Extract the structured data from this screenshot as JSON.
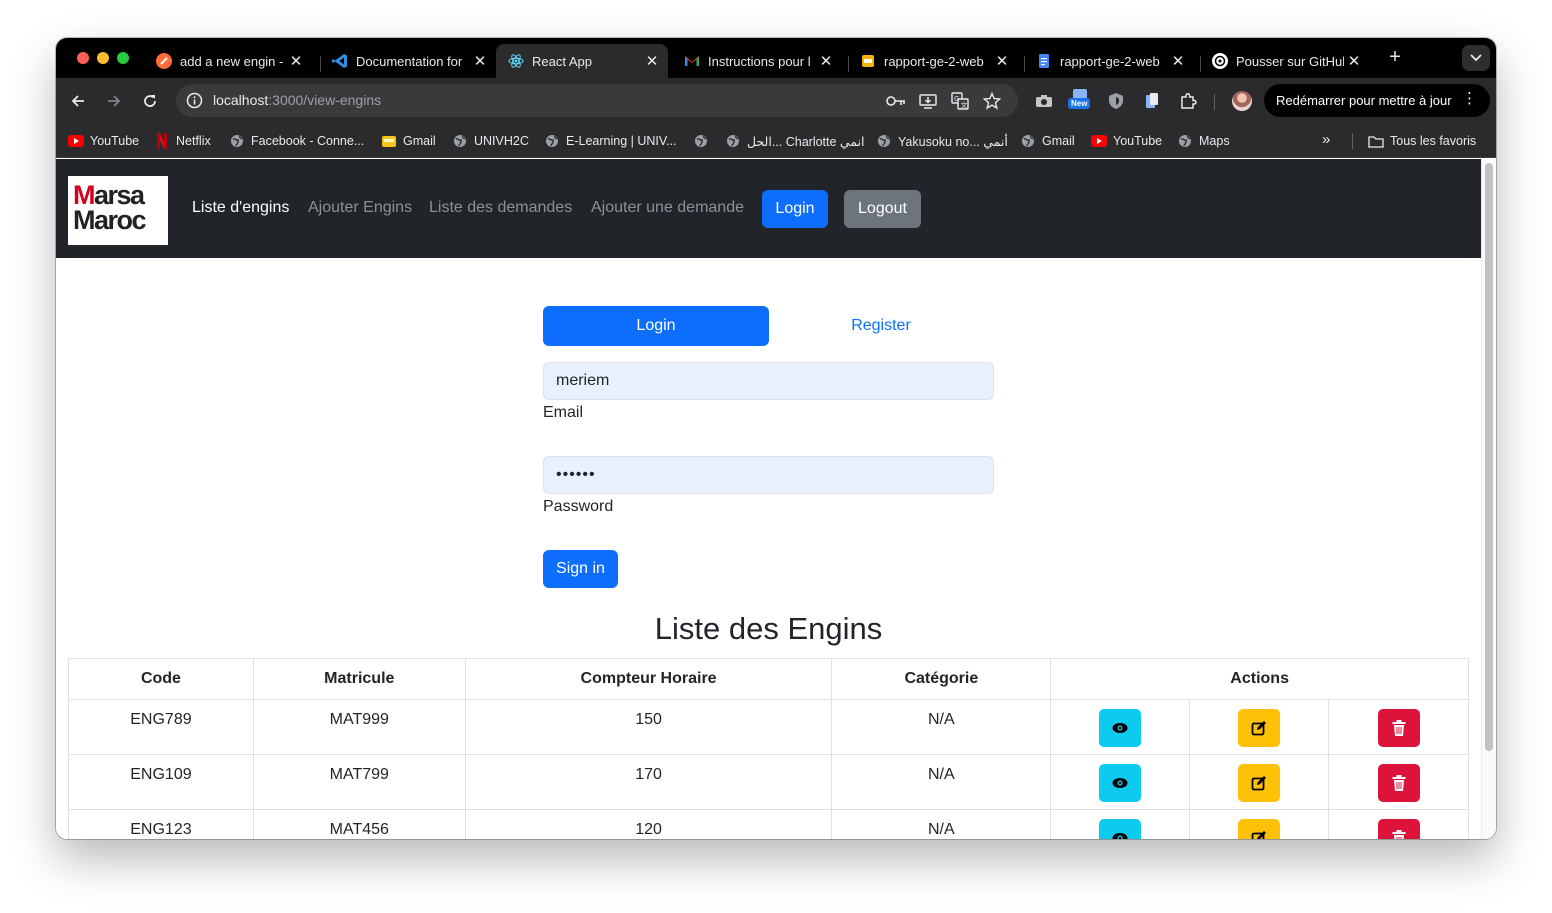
{
  "browser": {
    "tabs": [
      {
        "title": "add a new engin - ",
        "favicon": "postman-icon",
        "active": false
      },
      {
        "title": "Documentation for",
        "favicon": "vscode-icon",
        "active": false
      },
      {
        "title": "React App",
        "favicon": "react-icon",
        "active": true
      },
      {
        "title": "Instructions pour l",
        "favicon": "gmail-icon",
        "active": false
      },
      {
        "title": "rapport-ge-2-web",
        "favicon": "slides-icon",
        "active": false
      },
      {
        "title": "rapport-ge-2-web",
        "favicon": "docs-icon",
        "active": false
      },
      {
        "title": "Pousser sur GitHul",
        "favicon": "chatgpt-icon",
        "active": false
      }
    ],
    "url_host": "localhost",
    "url_path": ":3000/view-engins",
    "new_badge": "New",
    "update_button": "Redémarrer pour mettre à jour",
    "bookmarks": [
      {
        "label": "YouTube",
        "icon": "youtube-icon"
      },
      {
        "label": "Netflix",
        "icon": "netflix-icon"
      },
      {
        "label": "Facebook - Conne...",
        "icon": "globe-icon"
      },
      {
        "label": "Gmail",
        "icon": "folder-yellow-icon"
      },
      {
        "label": "UNIVH2C",
        "icon": "globe-icon"
      },
      {
        "label": "E-Learning | UNIV...",
        "icon": "globe-icon"
      },
      {
        "label": "",
        "icon": "globe-icon"
      },
      {
        "label": "الحل... Charlotte انمي",
        "icon": "globe-icon"
      },
      {
        "label": "Yakusoku no... أنمي",
        "icon": "globe-icon"
      },
      {
        "label": "Gmail",
        "icon": "globe-icon"
      },
      {
        "label": "YouTube",
        "icon": "youtube-icon"
      },
      {
        "label": "Maps",
        "icon": "globe-icon"
      }
    ],
    "all_bookmarks": "Tous les favoris"
  },
  "navbar": {
    "logo_line1_first": "M",
    "logo_line1_rest": "arsa",
    "logo_line2": "Maroc",
    "links": [
      "Liste d'engins",
      "Ajouter Engins",
      "Liste des demandes",
      "Ajouter une demande"
    ],
    "login": "Login",
    "logout": "Logout"
  },
  "auth": {
    "tab_login": "Login",
    "tab_register": "Register",
    "email_value": "meriem",
    "email_label": "Email",
    "password_value": "••••••",
    "password_label": "Password",
    "sign_in": "Sign in"
  },
  "engins": {
    "title": "Liste des Engins",
    "headers": [
      "Code",
      "Matricule",
      "Compteur Horaire",
      "Catégorie",
      "Actions"
    ],
    "rows": [
      {
        "code": "ENG789",
        "matricule": "MAT999",
        "compteur": "150",
        "categorie": "N/A"
      },
      {
        "code": "ENG109",
        "matricule": "MAT799",
        "compteur": "170",
        "categorie": "N/A"
      },
      {
        "code": "ENG123",
        "matricule": "MAT456",
        "compteur": "120",
        "categorie": "N/A"
      }
    ]
  },
  "colors": {
    "primary": "#0d6efd",
    "secondary": "#6c757d",
    "info": "#0dcaf0",
    "warning": "#ffc107",
    "danger": "#dc143c",
    "navbar": "#212529"
  }
}
